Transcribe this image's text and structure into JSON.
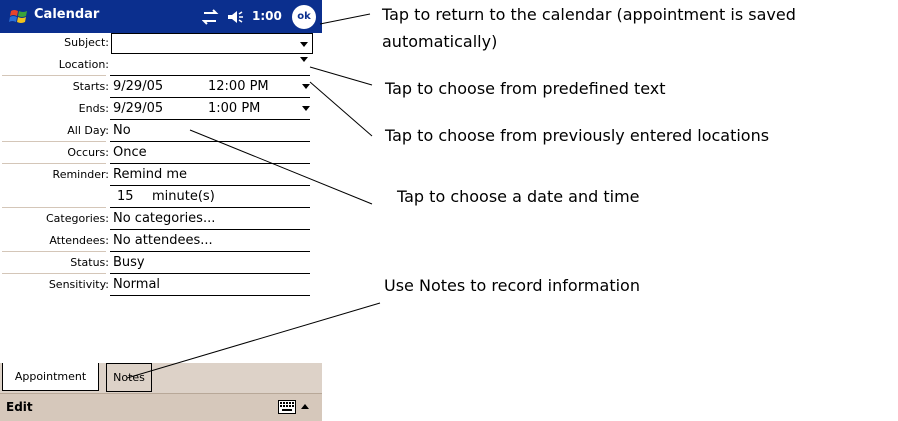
{
  "titlebar": {
    "app_title": "Calendar",
    "time": "1:00",
    "ok_label": "ok"
  },
  "form": {
    "subject": {
      "label": "Subject:",
      "value": ""
    },
    "location": {
      "label": "Location:",
      "value": ""
    },
    "starts": {
      "label": "Starts:",
      "date": "9/29/05",
      "time": "12:00 PM"
    },
    "ends": {
      "label": "Ends:",
      "date": "9/29/05",
      "time": "1:00 PM"
    },
    "all_day": {
      "label": "All Day:",
      "value": "No"
    },
    "occurs": {
      "label": "Occurs:",
      "value": "Once"
    },
    "reminder": {
      "label": "Reminder:",
      "value": "Remind me",
      "amount": "15",
      "unit": "minute(s)"
    },
    "categories": {
      "label": "Categories:",
      "value": "No categories..."
    },
    "attendees": {
      "label": "Attendees:",
      "value": "No attendees..."
    },
    "status": {
      "label": "Status:",
      "value": "Busy"
    },
    "sensitivity": {
      "label": "Sensitivity:",
      "value": "Normal"
    }
  },
  "tabs": [
    {
      "label": "Appointment"
    },
    {
      "label": "Notes"
    }
  ],
  "menubar": {
    "edit_label": "Edit"
  },
  "annotations": {
    "ok_line1": "Tap to return to the calendar (appointment is saved",
    "ok_line2": "automatically)",
    "predefined": "Tap to choose from predefined text",
    "locations": "Tap to choose from previously entered locations",
    "datetime": "Tap to choose a date and time",
    "notes": "Use Notes to record information"
  },
  "colors": {
    "titlebar_bg": "#0b2f8e",
    "tab_strip_bg": "#ddd2c8",
    "menubar_bg": "#d6c8bb"
  },
  "icons": [
    "windows-start-icon",
    "connectivity-icon",
    "speaker-icon",
    "ok-button",
    "keyboard-icon",
    "dropdown-arrow-icon"
  ]
}
